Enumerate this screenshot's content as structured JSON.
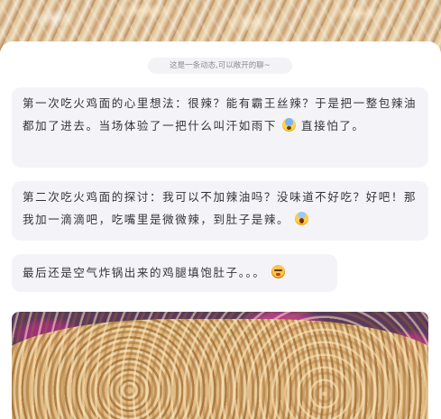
{
  "notice": {
    "text": "这是一条动态,可以敞开的聊~"
  },
  "messages": [
    {
      "text_before": "第一次吃火鸡面的心里想法：很辣？能有霸王丝辣？于是把一整包辣油都加了进去。当场体验了一把什么叫汗如雨下",
      "emoji": "fearful-face-icon",
      "text_after": "直接怕了。"
    },
    {
      "text_before": "第二次吃火鸡面的探讨：我可以不加辣油吗？没味道不好吃？好吧！那我加一滴滴吧，吃嘴里是微微辣，到肚子是辣。",
      "emoji": "screaming-face-icon",
      "text_after": ""
    },
    {
      "text_before": "最后还是空气炸锅出来的鸡腿填饱肚子。。。",
      "emoji": "tired-face-icon",
      "text_after": ""
    }
  ],
  "images": {
    "top": "noodles-photo",
    "bottom": "noodles-photo"
  }
}
